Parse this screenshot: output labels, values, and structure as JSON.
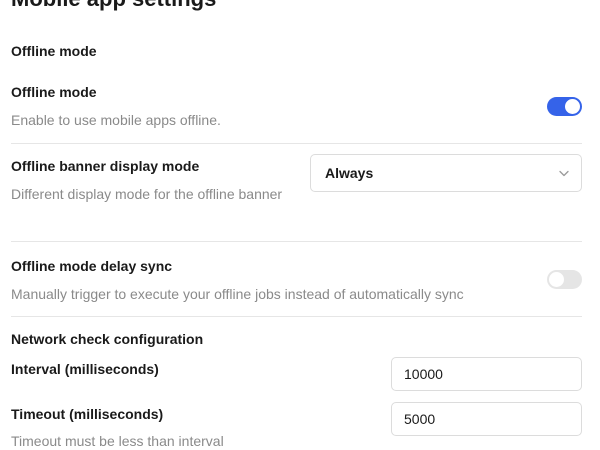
{
  "page": {
    "title": "Mobile app settings"
  },
  "offline_section": {
    "title": "Offline mode"
  },
  "offline_mode": {
    "label": "Offline mode",
    "description": "Enable to use mobile apps offline.",
    "enabled": true
  },
  "banner_display": {
    "label": "Offline banner display mode",
    "description": "Different display mode for the offline banner",
    "selected": "Always"
  },
  "delay_sync": {
    "label": "Offline mode delay sync",
    "description": "Manually trigger to execute your offline jobs instead of automatically sync",
    "enabled": false
  },
  "network_check": {
    "title": "Network check configuration",
    "interval_label": "Interval (milliseconds)",
    "interval_value": "10000",
    "timeout_label": "Timeout (milliseconds)",
    "timeout_value": "5000",
    "timeout_hint": "Timeout must be less than interval"
  },
  "colors": {
    "accent": "#3563e9",
    "toggle_off": "#e5e5e5",
    "muted_text": "#8a8a8a",
    "divider": "#e6e6e6"
  },
  "icons": {
    "select_chevron": "chevron-down-icon"
  }
}
